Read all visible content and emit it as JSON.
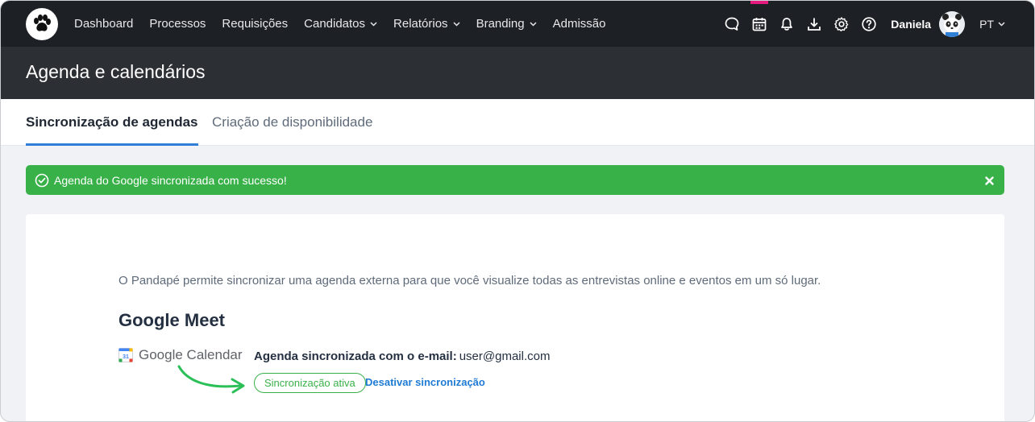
{
  "nav": {
    "items": [
      {
        "label": "Dashboard",
        "dropdown": false
      },
      {
        "label": "Processos",
        "dropdown": false
      },
      {
        "label": "Requisições",
        "dropdown": false
      },
      {
        "label": "Candidatos",
        "dropdown": true
      },
      {
        "label": "Relatórios",
        "dropdown": true
      },
      {
        "label": "Branding",
        "dropdown": true
      },
      {
        "label": "Admissão",
        "dropdown": false
      }
    ],
    "icons": [
      "chat-icon",
      "calendar-icon",
      "bell-icon",
      "download-icon",
      "gear-icon",
      "help-icon"
    ],
    "user_name": "Daniela",
    "language": "PT"
  },
  "header": {
    "title": "Agenda e calendários"
  },
  "tabs": [
    {
      "label": "Sincronização de agendas",
      "active": true
    },
    {
      "label": "Criação de disponibilidade",
      "active": false
    }
  ],
  "alert": {
    "message": "Agenda do Google sincronizada com sucesso!"
  },
  "card": {
    "intro": "O Pandapé permite sincronizar uma agenda externa para que você visualize todas as entrevistas online e eventos em um só lugar.",
    "section_title": "Google Meet",
    "provider_label": "Google Calendar",
    "provider_day": "31",
    "sync_label": "Agenda sincronizada com o e-mail:",
    "sync_email": "user@gmail.com",
    "status_badge": "Sincronização ativa",
    "deactivate_link": "Desativar sincronização"
  },
  "colors": {
    "nav_bg": "#1d2024",
    "header_bg": "#2c2f33",
    "success": "#39b149",
    "link": "#1f7bd3",
    "tab_underline": "#2f7fd6",
    "calendar_accent": "#e6197e"
  }
}
